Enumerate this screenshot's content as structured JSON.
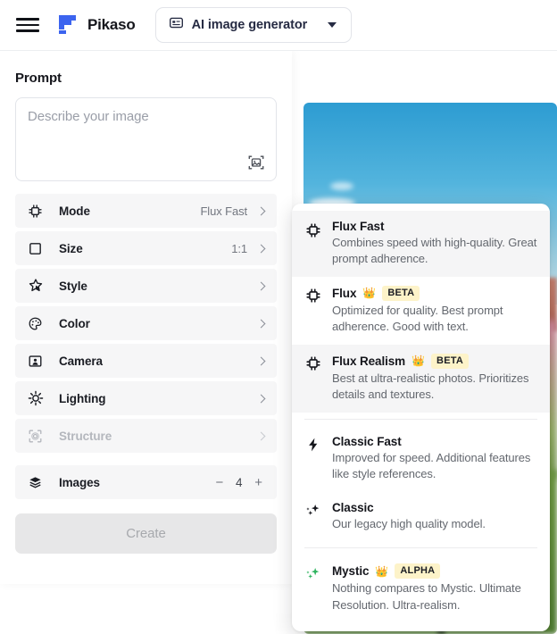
{
  "header": {
    "menu_icon": "hamburger-menu-icon",
    "logo_icon": "freepik-logo-icon",
    "brand": "Pikaso",
    "tool_selector": {
      "icon": "ai-generator-icon",
      "label": "AI image generator",
      "caret_icon": "chevron-down-icon"
    }
  },
  "panel": {
    "title": "Prompt",
    "prompt": {
      "value": "",
      "placeholder": "Describe your image",
      "image_ref_icon": "image-reference-icon"
    },
    "options": [
      {
        "icon": "chip-icon",
        "label": "Mode",
        "value": "Flux Fast",
        "disabled": false,
        "type": "nav"
      },
      {
        "icon": "square-icon",
        "label": "Size",
        "value": "1:1",
        "disabled": false,
        "type": "nav"
      },
      {
        "icon": "star-icon",
        "label": "Style",
        "value": "",
        "disabled": false,
        "type": "nav"
      },
      {
        "icon": "palette-icon",
        "label": "Color",
        "value": "",
        "disabled": false,
        "type": "nav"
      },
      {
        "icon": "camera-icon",
        "label": "Camera",
        "value": "",
        "disabled": false,
        "type": "nav"
      },
      {
        "icon": "lighting-icon",
        "label": "Lighting",
        "value": "",
        "disabled": false,
        "type": "nav"
      },
      {
        "icon": "structure-icon",
        "label": "Structure",
        "value": "",
        "disabled": true,
        "type": "nav"
      }
    ],
    "images_row": {
      "icon": "layers-icon",
      "label": "Images",
      "decrement": "−",
      "count": "4",
      "increment": "+"
    },
    "create_button": "Create"
  },
  "dropdown": {
    "items": [
      {
        "icon": "chip-icon",
        "title": "Flux Fast",
        "crown": "",
        "badge": "",
        "desc": "Combines speed with high-quality. Great prompt adherence.",
        "selected": true,
        "divider_after": false
      },
      {
        "icon": "chip-icon",
        "title": "Flux",
        "crown": "👑",
        "badge": "BETA",
        "desc": "Optimized for quality. Best prompt adherence. Good with text.",
        "selected": false,
        "divider_after": false
      },
      {
        "icon": "chip-icon",
        "title": "Flux Realism",
        "crown": "👑",
        "badge": "BETA",
        "desc": "Best at ultra-realistic photos. Prioritizes details and textures.",
        "selected": true,
        "divider_after": true
      },
      {
        "icon": "bolt-icon",
        "title": "Classic Fast",
        "crown": "",
        "badge": "",
        "desc": "Improved for speed. Additional features like style references.",
        "selected": false,
        "divider_after": false
      },
      {
        "icon": "sparkle-dark-icon",
        "title": "Classic",
        "crown": "",
        "badge": "",
        "desc": "Our legacy high quality model.",
        "selected": false,
        "divider_after": true
      },
      {
        "icon": "sparkle-green-icon",
        "title": "Mystic",
        "crown": "👑",
        "badge": "ALPHA",
        "desc": "Nothing compares to Mystic. Ultimate Resolution. Ultra-realism.",
        "selected": false,
        "divider_after": false
      }
    ]
  },
  "colors": {
    "accent": "#3c64ef",
    "badge_bg": "#fdf3c9",
    "pill_text": "#262b43",
    "row_bg": "#f6f6f7"
  }
}
